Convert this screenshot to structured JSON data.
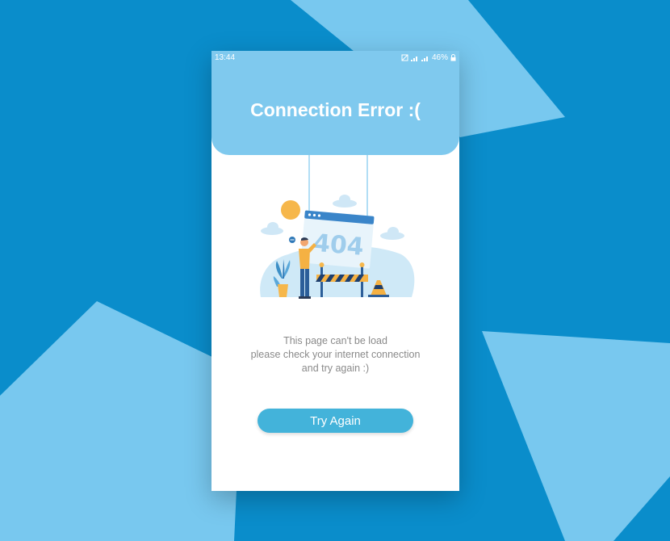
{
  "status_bar": {
    "time": "13:44",
    "battery": "46%",
    "icons": [
      "mute-icon",
      "signal-icon",
      "signal-icon",
      "lock-icon"
    ]
  },
  "header": {
    "title": "Connection Error :("
  },
  "illustration": {
    "error_code": "404",
    "icons": [
      "sun-icon",
      "cloud-icon",
      "browser-window-icon",
      "worker-icon",
      "plant-icon",
      "barrier-icon",
      "traffic-cone-icon"
    ]
  },
  "message": {
    "line1": "This page can't be load",
    "line2": "please check your internet connection",
    "line3": "and try again :)"
  },
  "button": {
    "label": "Try Again"
  },
  "colors": {
    "background": "#0a8dcb",
    "background_shape": "#78c8ef",
    "header": "#7fc9ee",
    "button": "#43b3da",
    "text_muted": "#8a8a8a"
  }
}
